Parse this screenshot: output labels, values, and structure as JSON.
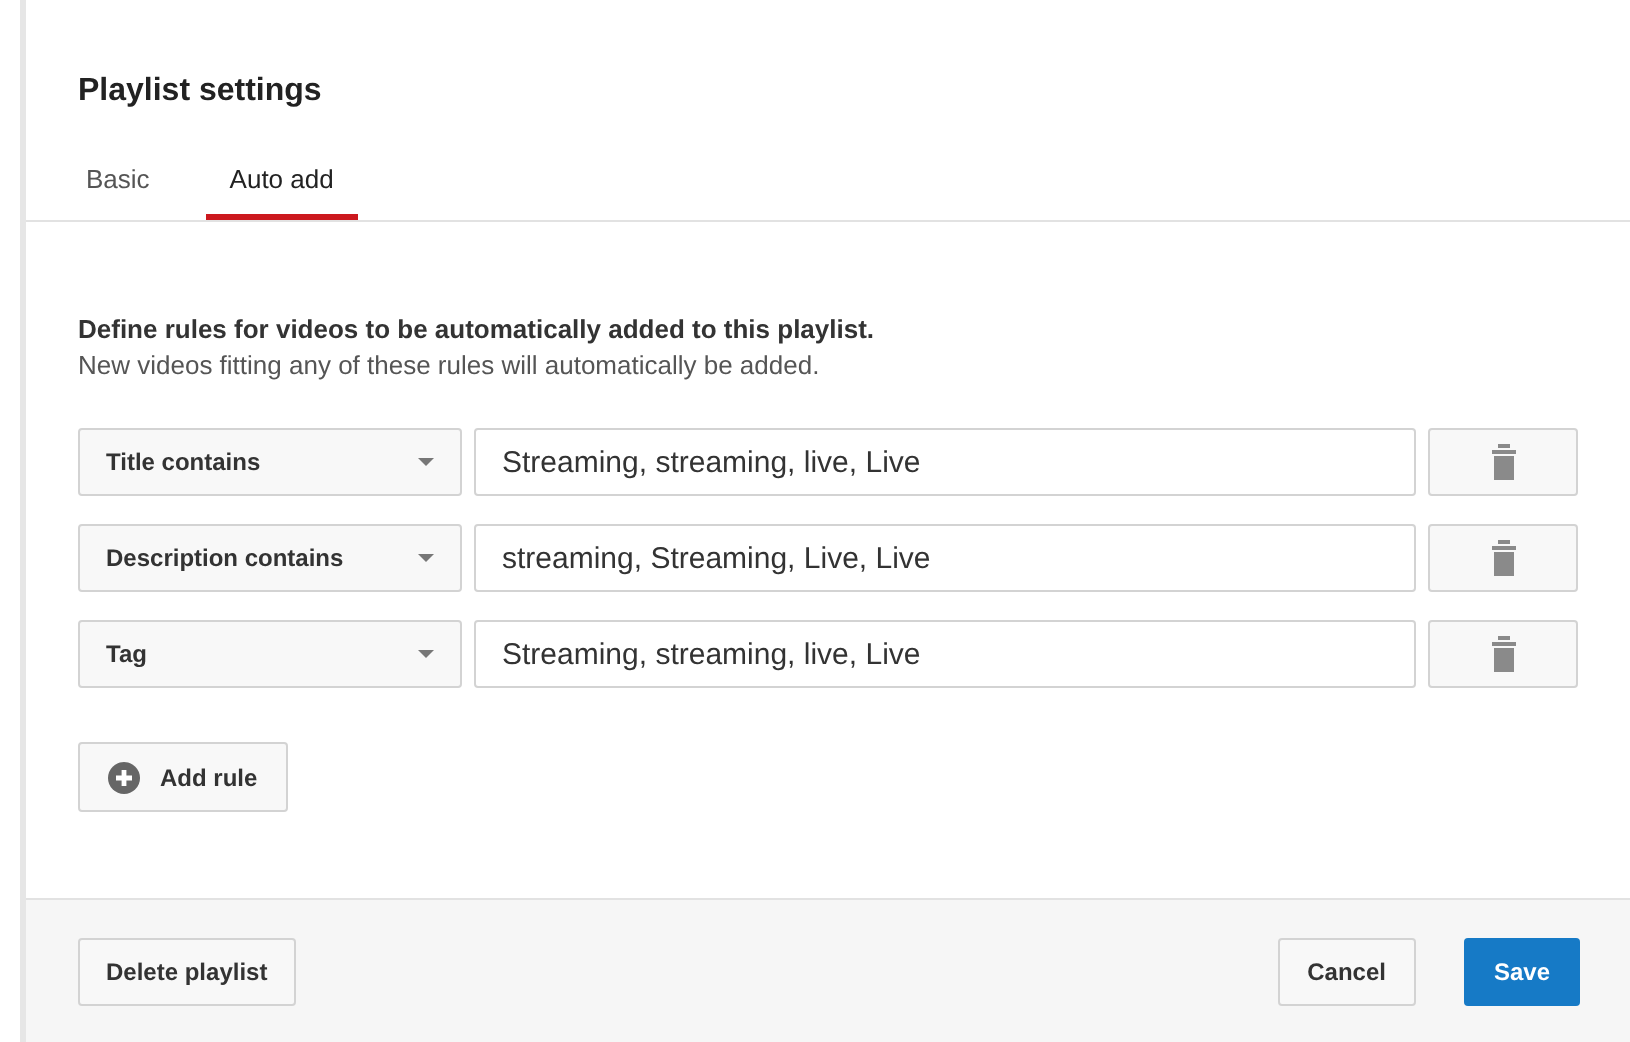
{
  "title": "Playlist settings",
  "tabs": [
    {
      "label": "Basic",
      "selected": false
    },
    {
      "label": "Auto add",
      "selected": true
    }
  ],
  "intro": {
    "heading": "Define rules for videos to be automatically added to this playlist.",
    "text": "New videos fitting any of these rules will automatically be added."
  },
  "rules": [
    {
      "field": "Title contains",
      "value": "Streaming, streaming, live, Live"
    },
    {
      "field": "Description contains",
      "value": "streaming, Streaming, Live, Live"
    },
    {
      "field": "Tag",
      "value": "Streaming, streaming, live, Live"
    }
  ],
  "add_rule": "Add rule",
  "footer": {
    "delete": "Delete playlist",
    "cancel": "Cancel",
    "save": "Save"
  }
}
